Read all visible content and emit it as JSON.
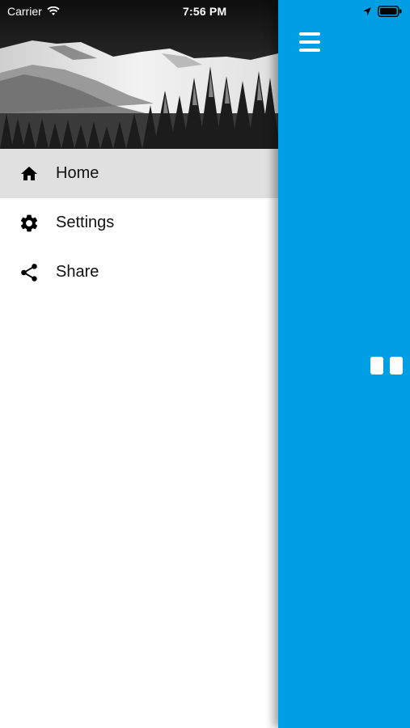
{
  "status_bar": {
    "carrier": "Carrier",
    "time": "7:56 PM"
  },
  "drawer": {
    "header_image": "snowy-mountain-forest-photo",
    "menu": [
      {
        "label": "Home",
        "icon": "home-icon",
        "selected": true
      },
      {
        "label": "Settings",
        "icon": "gear-icon",
        "selected": false
      },
      {
        "label": "Share",
        "icon": "share-icon",
        "selected": false
      }
    ]
  },
  "main": {
    "background_color": "#009fe3",
    "menu_button_icon": "hamburger-icon"
  }
}
